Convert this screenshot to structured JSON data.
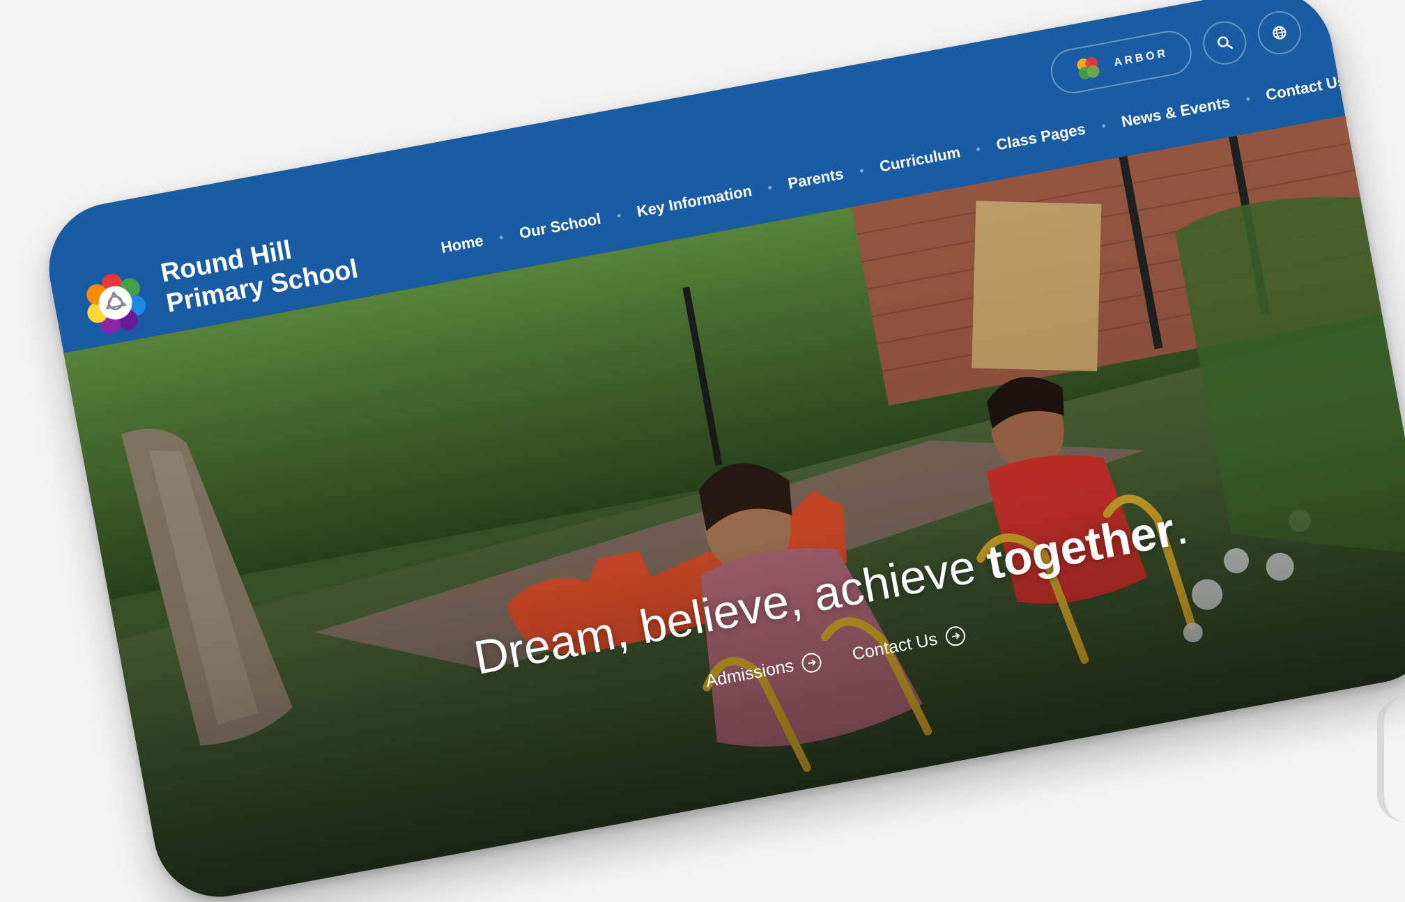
{
  "school": {
    "name_line1": "Round Hill",
    "name_line2": "Primary School"
  },
  "nav": {
    "items": [
      {
        "label": "Home"
      },
      {
        "label": "Our School"
      },
      {
        "label": "Key Information"
      },
      {
        "label": "Parents"
      },
      {
        "label": "Curriculum"
      },
      {
        "label": "Class Pages"
      },
      {
        "label": "News & Events"
      },
      {
        "label": "Contact Us"
      }
    ]
  },
  "utility": {
    "arbor_label": "ARBOR",
    "search_icon": "search-icon",
    "globe_icon": "globe-icon"
  },
  "hero": {
    "tagline_part1": "Dream, believe, achieve ",
    "tagline_part2": "together",
    "tagline_part3": ".",
    "cta_admissions": "Admissions",
    "cta_contact": "Contact Us"
  },
  "colors": {
    "header_blue": "#1a5ca3",
    "white": "#ffffff",
    "background": "#f4f4f5"
  }
}
